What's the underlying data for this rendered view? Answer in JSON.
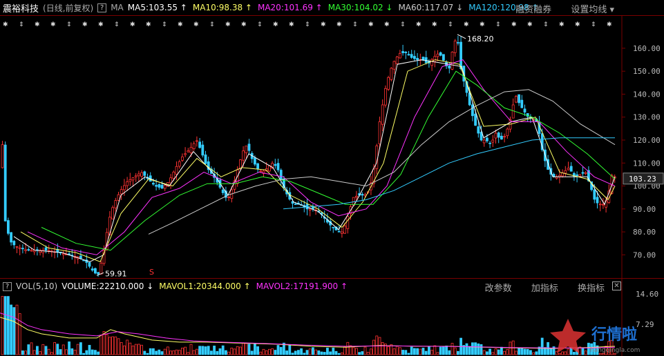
{
  "header": {
    "stock_name": "震裕科技",
    "mode": "(日线,前复权)",
    "help": "?",
    "ma_label": "MA",
    "ma": [
      {
        "label": "MA5:103.55",
        "arrow": "↑",
        "color": "#ffffff"
      },
      {
        "label": "MA10:98.38",
        "arrow": "↑",
        "color": "#ffff66"
      },
      {
        "label": "MA20:101.69",
        "arrow": "↑",
        "color": "#ff33ff"
      },
      {
        "label": "MA30:104.02",
        "arrow": "↓",
        "color": "#33ff33"
      },
      {
        "label": "MA60:117.07",
        "arrow": "↓",
        "color": "#cccccc"
      },
      {
        "label": "MA120:120.98",
        "arrow": "↑",
        "color": "#33ccff"
      }
    ],
    "links": [
      "融资融券",
      "设置均线 ▾"
    ]
  },
  "vol_header": {
    "help": "?",
    "label": "VOL(5,10)",
    "items": [
      {
        "label": "VOLUME:22210.000",
        "arrow": "↓",
        "color": "#ffffff"
      },
      {
        "label": "MAVOL1:20344.000",
        "arrow": "↑",
        "color": "#ffff66"
      },
      {
        "label": "MAVOL2:17191.900",
        "arrow": "↑",
        "color": "#ff33ff"
      }
    ],
    "links": [
      "改参数",
      "加指标",
      "换指标"
    ],
    "close": "✕"
  },
  "annotations": {
    "high": "168.20",
    "low": "59.91",
    "s_marker": "S"
  },
  "watermark": {
    "text": "行情啦",
    "sub": "hangqingla.com"
  },
  "colors": {
    "up": "#ff3333",
    "down": "#33ccff",
    "bg": "#000000",
    "axis": "#7a0000"
  },
  "chart_data": {
    "type": "line",
    "ylabel_ticks": [
      70,
      80,
      90,
      100,
      110,
      120,
      130,
      140,
      150,
      160
    ],
    "tick_labels": [
      "70.00",
      "80.00",
      "90.00",
      "100.00",
      "110.00",
      "120.00",
      "130.00",
      "140.00",
      "150.00",
      "160.00"
    ],
    "ylim": [
      62,
      172
    ],
    "current_price": "103.23",
    "price_path": [
      [
        0,
        108
      ],
      [
        4,
        118
      ],
      [
        8,
        85
      ],
      [
        15,
        76
      ],
      [
        22,
        74
      ],
      [
        30,
        73
      ],
      [
        40,
        72
      ],
      [
        55,
        72
      ],
      [
        70,
        72
      ],
      [
        85,
        71
      ],
      [
        100,
        70
      ],
      [
        115,
        69
      ],
      [
        125,
        67
      ],
      [
        135,
        63
      ],
      [
        142,
        61
      ],
      [
        150,
        70
      ],
      [
        158,
        85
      ],
      [
        165,
        92
      ],
      [
        175,
        98
      ],
      [
        185,
        102
      ],
      [
        195,
        104
      ],
      [
        205,
        106
      ],
      [
        215,
        103
      ],
      [
        225,
        100
      ],
      [
        235,
        99
      ],
      [
        245,
        102
      ],
      [
        255,
        108
      ],
      [
        265,
        113
      ],
      [
        275,
        116
      ],
      [
        285,
        120
      ],
      [
        292,
        115
      ],
      [
        300,
        108
      ],
      [
        310,
        104
      ],
      [
        318,
        100
      ],
      [
        325,
        96
      ],
      [
        330,
        94
      ],
      [
        338,
        100
      ],
      [
        345,
        108
      ],
      [
        352,
        115
      ],
      [
        358,
        118
      ],
      [
        365,
        112
      ],
      [
        372,
        108
      ],
      [
        380,
        106
      ],
      [
        388,
        108
      ],
      [
        395,
        110
      ],
      [
        402,
        108
      ],
      [
        410,
        100
      ],
      [
        418,
        95
      ],
      [
        425,
        92
      ],
      [
        435,
        92
      ],
      [
        445,
        90
      ],
      [
        455,
        90
      ],
      [
        465,
        88
      ],
      [
        475,
        84
      ],
      [
        482,
        82
      ],
      [
        490,
        80
      ],
      [
        497,
        80
      ],
      [
        505,
        88
      ],
      [
        512,
        95
      ],
      [
        520,
        96
      ],
      [
        528,
        96
      ],
      [
        535,
        98
      ],
      [
        542,
        108
      ],
      [
        550,
        128
      ],
      [
        558,
        142
      ],
      [
        565,
        150
      ],
      [
        572,
        155
      ],
      [
        580,
        158
      ],
      [
        588,
        158
      ],
      [
        596,
        156
      ],
      [
        604,
        155
      ],
      [
        612,
        155
      ],
      [
        620,
        153
      ],
      [
        628,
        156
      ],
      [
        636,
        158
      ],
      [
        644,
        154
      ],
      [
        650,
        150
      ],
      [
        656,
        160
      ],
      [
        662,
        166
      ],
      [
        668,
        150
      ],
      [
        675,
        142
      ],
      [
        682,
        133
      ],
      [
        690,
        125
      ],
      [
        697,
        120
      ],
      [
        704,
        120
      ],
      [
        711,
        118
      ],
      [
        718,
        123
      ],
      [
        725,
        120
      ],
      [
        732,
        122
      ],
      [
        740,
        130
      ],
      [
        746,
        140
      ],
      [
        752,
        136
      ],
      [
        758,
        133
      ],
      [
        765,
        130
      ],
      [
        772,
        129
      ],
      [
        778,
        128
      ],
      [
        785,
        116
      ],
      [
        792,
        108
      ],
      [
        800,
        104
      ],
      [
        808,
        104
      ],
      [
        816,
        106
      ],
      [
        824,
        108
      ],
      [
        832,
        104
      ],
      [
        840,
        105
      ],
      [
        848,
        106
      ],
      [
        855,
        100
      ],
      [
        862,
        93
      ],
      [
        870,
        92
      ],
      [
        876,
        92
      ],
      [
        882,
        98
      ],
      [
        888,
        108
      ],
      [
        890,
        104
      ]
    ],
    "series": [
      {
        "name": "MA5",
        "color": "#ffffff",
        "values": [
          [
            20,
            78
          ],
          [
            50,
            72
          ],
          [
            90,
            71
          ],
          [
            130,
            67
          ],
          [
            150,
            70
          ],
          [
            175,
            96
          ],
          [
            210,
            104
          ],
          [
            245,
            100
          ],
          [
            280,
            115
          ],
          [
            310,
            105
          ],
          [
            330,
            96
          ],
          [
            360,
            114
          ],
          [
            395,
            108
          ],
          [
            425,
            93
          ],
          [
            460,
            89
          ],
          [
            490,
            81
          ],
          [
            515,
            93
          ],
          [
            545,
            110
          ],
          [
            575,
            153
          ],
          [
            610,
            155
          ],
          [
            650,
            153
          ],
          [
            668,
            152
          ],
          [
            700,
            121
          ],
          [
            740,
            128
          ],
          [
            770,
            130
          ],
          [
            800,
            104
          ],
          [
            850,
            104
          ],
          [
            875,
            92
          ],
          [
            890,
            104
          ]
        ]
      },
      {
        "name": "MA10",
        "color": "#ffff66",
        "values": [
          [
            30,
            80
          ],
          [
            70,
            73
          ],
          [
            110,
            71
          ],
          [
            145,
            67
          ],
          [
            175,
            88
          ],
          [
            215,
            103
          ],
          [
            250,
            100
          ],
          [
            285,
            112
          ],
          [
            320,
            104
          ],
          [
            350,
            108
          ],
          [
            385,
            107
          ],
          [
            420,
            96
          ],
          [
            460,
            90
          ],
          [
            495,
            82
          ],
          [
            525,
            93
          ],
          [
            555,
            110
          ],
          [
            590,
            150
          ],
          [
            630,
            155
          ],
          [
            665,
            153
          ],
          [
            700,
            126
          ],
          [
            740,
            127
          ],
          [
            775,
            130
          ],
          [
            810,
            106
          ],
          [
            850,
            103
          ],
          [
            880,
            94
          ],
          [
            890,
            100
          ]
        ]
      },
      {
        "name": "MA20",
        "color": "#ff33ff",
        "values": [
          [
            40,
            80
          ],
          [
            90,
            73
          ],
          [
            140,
            70
          ],
          [
            180,
            80
          ],
          [
            220,
            95
          ],
          [
            260,
            99
          ],
          [
            295,
            106
          ],
          [
            335,
            101
          ],
          [
            375,
            106
          ],
          [
            410,
            104
          ],
          [
            450,
            93
          ],
          [
            490,
            87
          ],
          [
            530,
            90
          ],
          [
            560,
            100
          ],
          [
            600,
            130
          ],
          [
            640,
            152
          ],
          [
            670,
            155
          ],
          [
            700,
            142
          ],
          [
            740,
            128
          ],
          [
            780,
            128
          ],
          [
            820,
            115
          ],
          [
            860,
            104
          ],
          [
            890,
            100
          ]
        ]
      },
      {
        "name": "MA30",
        "color": "#33ff33",
        "values": [
          [
            60,
            82
          ],
          [
            110,
            75
          ],
          [
            160,
            72
          ],
          [
            210,
            85
          ],
          [
            260,
            96
          ],
          [
            300,
            101
          ],
          [
            340,
            101
          ],
          [
            380,
            104
          ],
          [
            420,
            102
          ],
          [
            460,
            97
          ],
          [
            500,
            92
          ],
          [
            540,
            92
          ],
          [
            580,
            105
          ],
          [
            620,
            130
          ],
          [
            660,
            150
          ],
          [
            690,
            144
          ],
          [
            730,
            134
          ],
          [
            770,
            130
          ],
          [
            810,
            123
          ],
          [
            850,
            114
          ],
          [
            890,
            103
          ]
        ]
      },
      {
        "name": "MA60",
        "color": "#cccccc",
        "values": [
          [
            215,
            79
          ],
          [
            250,
            84
          ],
          [
            290,
            90
          ],
          [
            330,
            96
          ],
          [
            370,
            100
          ],
          [
            410,
            103
          ],
          [
            450,
            104
          ],
          [
            490,
            102
          ],
          [
            530,
            100
          ],
          [
            570,
            106
          ],
          [
            610,
            118
          ],
          [
            650,
            128
          ],
          [
            690,
            135
          ],
          [
            730,
            141
          ],
          [
            765,
            142
          ],
          [
            800,
            137
          ],
          [
            840,
            127
          ],
          [
            890,
            118
          ]
        ]
      },
      {
        "name": "MA120",
        "color": "#33ccff",
        "values": [
          [
            410,
            90
          ],
          [
            450,
            91
          ],
          [
            490,
            92
          ],
          [
            530,
            94
          ],
          [
            570,
            98
          ],
          [
            610,
            104
          ],
          [
            650,
            110
          ],
          [
            690,
            114
          ],
          [
            730,
            117
          ],
          [
            770,
            120
          ],
          [
            810,
            121
          ],
          [
            850,
            121
          ],
          [
            890,
            121
          ]
        ]
      }
    ],
    "volume": {
      "ylim": [
        0,
        14.6
      ],
      "tick_labels": [
        "14.60",
        "7.29"
      ],
      "note": "volume bars scaled to 14.6 max",
      "ma_lines": [
        {
          "name": "MAVOL1",
          "color": "#ffff66",
          "values": [
            [
              0,
              9
            ],
            [
              20,
              8
            ],
            [
              40,
              6
            ],
            [
              60,
              5
            ],
            [
              100,
              4
            ],
            [
              140,
              4
            ],
            [
              160,
              6
            ],
            [
              180,
              5
            ],
            [
              220,
              3.5
            ],
            [
              260,
              3
            ],
            [
              300,
              3
            ],
            [
              340,
              2.8
            ],
            [
              400,
              2.5
            ],
            [
              450,
              2
            ],
            [
              500,
              1.8
            ],
            [
              550,
              2.2
            ],
            [
              600,
              2
            ],
            [
              650,
              2
            ],
            [
              700,
              1.8
            ],
            [
              750,
              1.6
            ],
            [
              800,
              1.5
            ],
            [
              850,
              1.7
            ],
            [
              890,
              2
            ]
          ]
        },
        {
          "name": "MAVOL2",
          "color": "#ff33ff",
          "values": [
            [
              0,
              10
            ],
            [
              20,
              9
            ],
            [
              40,
              7
            ],
            [
              60,
              6
            ],
            [
              100,
              5
            ],
            [
              140,
              4.5
            ],
            [
              170,
              5.5
            ],
            [
              200,
              5
            ],
            [
              240,
              4
            ],
            [
              280,
              3.3
            ],
            [
              320,
              3
            ],
            [
              380,
              2.7
            ],
            [
              440,
              2.3
            ],
            [
              500,
              2
            ],
            [
              560,
              2.1
            ],
            [
              620,
              2
            ],
            [
              680,
              1.9
            ],
            [
              740,
              1.7
            ],
            [
              800,
              1.6
            ],
            [
              850,
              1.6
            ],
            [
              890,
              1.8
            ]
          ]
        }
      ]
    }
  }
}
